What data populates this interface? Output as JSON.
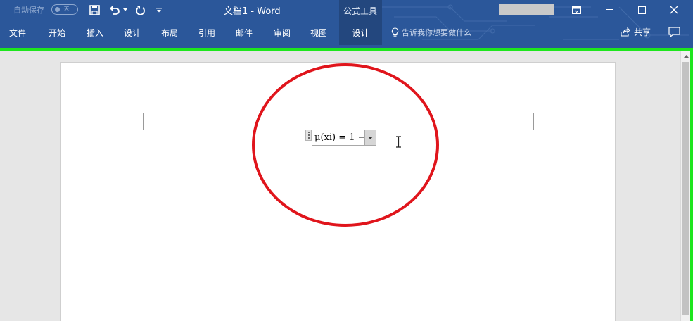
{
  "titlebar": {
    "autosave_label": "自动保存",
    "autosave_state": "关",
    "doc_title": "文档1  -  Word",
    "context_group": "公式工具",
    "colors": {
      "ribbon": "#2b579a",
      "context_tab": "#23477e"
    }
  },
  "quick_access": {
    "save_icon": "save-icon",
    "undo_icon": "undo-icon",
    "redo_icon": "redo-icon",
    "customize_icon": "customize-icon"
  },
  "tabs": [
    {
      "label": "文件"
    },
    {
      "label": "开始"
    },
    {
      "label": "插入"
    },
    {
      "label": "设计"
    },
    {
      "label": "布局"
    },
    {
      "label": "引用"
    },
    {
      "label": "邮件"
    },
    {
      "label": "审阅"
    },
    {
      "label": "视图"
    },
    {
      "label": "设计",
      "active": true
    }
  ],
  "tell_me": "告诉我你想要做什么",
  "share_label": "共享",
  "window_buttons": [
    "ribbon-display-icon",
    "minimize-icon",
    "maximize-icon",
    "close-icon"
  ],
  "equation": {
    "text": "μ(xi) = 1 −"
  },
  "annotations": {
    "circle_color": "#e0151c",
    "frame_color": "#1ee61e"
  }
}
